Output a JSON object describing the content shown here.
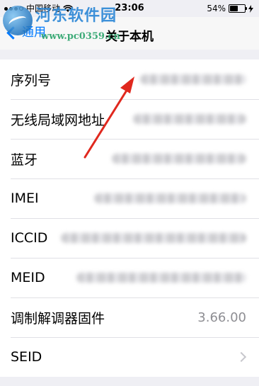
{
  "status_bar": {
    "carrier": "中国移动",
    "time": "23:06",
    "battery": "54%",
    "battery_level": 0.54
  },
  "nav": {
    "back_label": "通用",
    "title": "关于本机"
  },
  "watermark": {
    "title": "河东软件园",
    "url": "www.pc0359.cn"
  },
  "rows": [
    {
      "label": "序列号",
      "value": ""
    },
    {
      "label": "无线局域网地址",
      "value": ""
    },
    {
      "label": "蓝牙",
      "value": ""
    },
    {
      "label": "IMEI",
      "value": ""
    },
    {
      "label": "ICCID",
      "value": ""
    },
    {
      "label": "MEID",
      "value": ""
    },
    {
      "label": "调制解调器固件",
      "value": "3.66.00"
    },
    {
      "label": "SEID",
      "value": ""
    }
  ],
  "colors": {
    "accent": "#007aff",
    "arrow": "#e0281e",
    "background": "#efeff4"
  },
  "icons": [
    "wifi-icon",
    "battery-icon",
    "charging-icon",
    "back-chevron-icon",
    "disclosure-chevron-icon"
  ]
}
